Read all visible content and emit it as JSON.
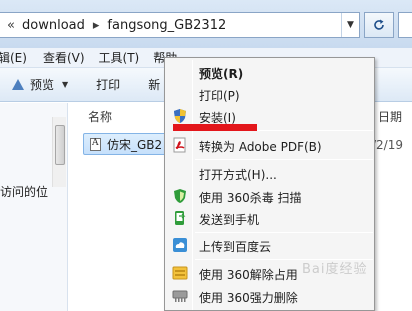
{
  "address_bar": {
    "chevron": "«",
    "path": [
      "download",
      "fangsong_GB2312"
    ],
    "separator": "▸",
    "dropdown_arrow": "▼",
    "refresh_icon": "refresh-icon"
  },
  "menu_bar": {
    "items": [
      "辑(E)",
      "查看(V)",
      "工具(T)",
      "帮助"
    ]
  },
  "toolbar": {
    "preview_label": "预览",
    "preview_caret": "▼",
    "print_label": "打印",
    "new_label": "新"
  },
  "nav_pane": {
    "partial_text": "访问的位"
  },
  "file_list": {
    "column_name": "名称",
    "column_date": "日期",
    "file": {
      "name": "仿宋_GB2",
      "date": "/2/19"
    }
  },
  "context_menu": {
    "items": [
      {
        "label": "预览(R)",
        "bold": true
      },
      {
        "label": "打印(P)",
        "bold": false
      },
      {
        "label": "安装(I)",
        "bold": false,
        "icon": "uac-shield-icon"
      },
      {
        "label": "转换为 Adobe PDF(B)",
        "bold": false,
        "icon": "adobe-pdf-icon"
      },
      {
        "label": "打开方式(H)...",
        "bold": false
      },
      {
        "label": "使用 360杀毒 扫描",
        "bold": false,
        "icon": "360-antivirus-icon"
      },
      {
        "label": "发送到手机",
        "bold": false,
        "icon": "send-to-phone-icon"
      },
      {
        "label": "上传到百度云",
        "bold": false,
        "icon": "baidu-cloud-icon"
      },
      {
        "label": "使用 360解除占用",
        "bold": false,
        "icon": "360-unlock-icon"
      },
      {
        "label": "使用 360强力删除",
        "bold": false,
        "icon": "360-shred-icon"
      }
    ]
  },
  "watermark": "Bai度经验",
  "colors": {
    "highlight_mark": "#e3161b",
    "selection_fill": "#c6e0fb",
    "toolbar_bg": "#dde9f6"
  }
}
